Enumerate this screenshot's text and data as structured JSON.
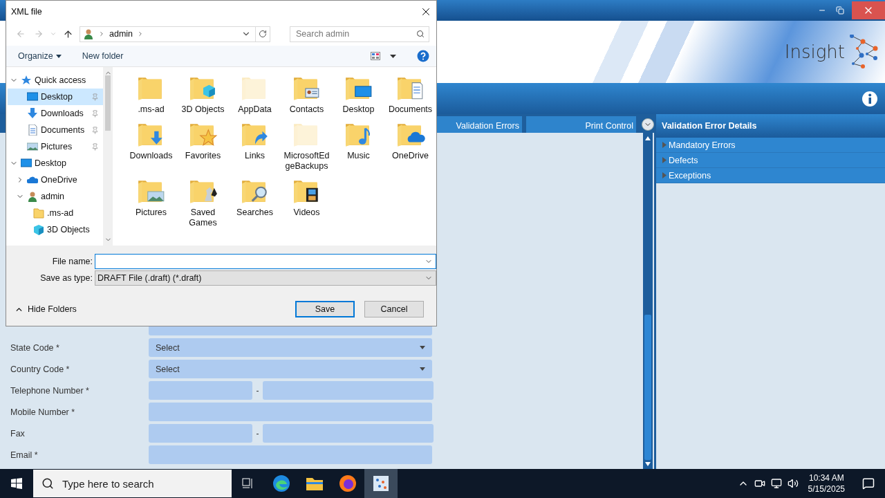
{
  "app": {
    "logo": "Insight",
    "tabs": [
      {
        "label": "Validation Errors",
        "selected": false
      },
      {
        "label": "Print Control",
        "selected": false
      }
    ],
    "form": [
      {
        "kind": "text"
      },
      {
        "label": "State Code *",
        "kind": "select",
        "value": "Select"
      },
      {
        "label": "Country Code *",
        "kind": "select",
        "value": "Select"
      },
      {
        "label": "Telephone Number *",
        "kind": "split",
        "separator": "-"
      },
      {
        "label": "Mobile Number *",
        "kind": "text"
      },
      {
        "label": "Fax",
        "kind": "split",
        "separator": "-"
      },
      {
        "label": "Email *",
        "kind": "text"
      }
    ],
    "details": {
      "title": "Validation Error Details",
      "items": [
        {
          "label": "Mandatory Errors",
          "expanded": false
        },
        {
          "label": "Defects",
          "expanded": false
        },
        {
          "label": "Exceptions",
          "expanded": false
        }
      ]
    }
  },
  "dialog": {
    "title": "XML file",
    "address": "admin",
    "search": {
      "placeholder": "Search admin"
    },
    "commands": [
      "Organize",
      "New folder"
    ],
    "tree": [
      {
        "label": "Quick access",
        "kind": "star",
        "expanded": true,
        "children": [
          {
            "label": "Desktop",
            "kind": "desktop",
            "selected": true,
            "pinned": true
          },
          {
            "label": "Downloads",
            "kind": "download",
            "selected": false,
            "pinned": true
          },
          {
            "label": "Documents",
            "kind": "document",
            "selected": false,
            "pinned": true
          },
          {
            "label": "Pictures",
            "kind": "picture",
            "selected": false,
            "pinned": true
          }
        ]
      },
      {
        "label": "Desktop",
        "kind": "desktop",
        "expanded": true,
        "children": [
          {
            "label": "OneDrive",
            "kind": "cloud",
            "expanded": false
          },
          {
            "label": "admin",
            "kind": "user",
            "expanded": true,
            "children": [
              {
                "label": ".ms-ad",
                "kind": "folder"
              },
              {
                "label": "3D Objects",
                "kind": "cube"
              }
            ]
          }
        ]
      }
    ],
    "files": [
      {
        "name": ".ms-ad",
        "kind": "folder"
      },
      {
        "name": "3D Objects",
        "kind": "cube"
      },
      {
        "name": "AppData",
        "kind": "faded"
      },
      {
        "name": "Contacts",
        "kind": "contact"
      },
      {
        "name": "Desktop",
        "kind": "desktop"
      },
      {
        "name": "Documents",
        "kind": "document"
      },
      {
        "name": "Downloads",
        "kind": "download"
      },
      {
        "name": "Favorites",
        "kind": "star"
      },
      {
        "name": "Links",
        "kind": "link"
      },
      {
        "name": "MicrosoftEdgeBackups",
        "kind": "faded"
      },
      {
        "name": "Music",
        "kind": "music"
      },
      {
        "name": "OneDrive",
        "kind": "cloud"
      },
      {
        "name": "Pictures",
        "kind": "picture"
      },
      {
        "name": "Saved Games",
        "kind": "chess"
      },
      {
        "name": "Searches",
        "kind": "search"
      },
      {
        "name": "Videos",
        "kind": "video"
      }
    ],
    "file_name_label": "File name:",
    "save_type_label": "Save as type:",
    "save_type": "DRAFT File (.draft) (*.draft)",
    "hide_folders": "Hide Folders",
    "buttons": [
      {
        "label": "Save",
        "kind": "default"
      },
      {
        "label": "Cancel",
        "kind": "normal"
      }
    ]
  },
  "taskbar": {
    "search_placeholder": "Type here to search",
    "time": "10:34 AM",
    "date": "5/15/2025"
  }
}
